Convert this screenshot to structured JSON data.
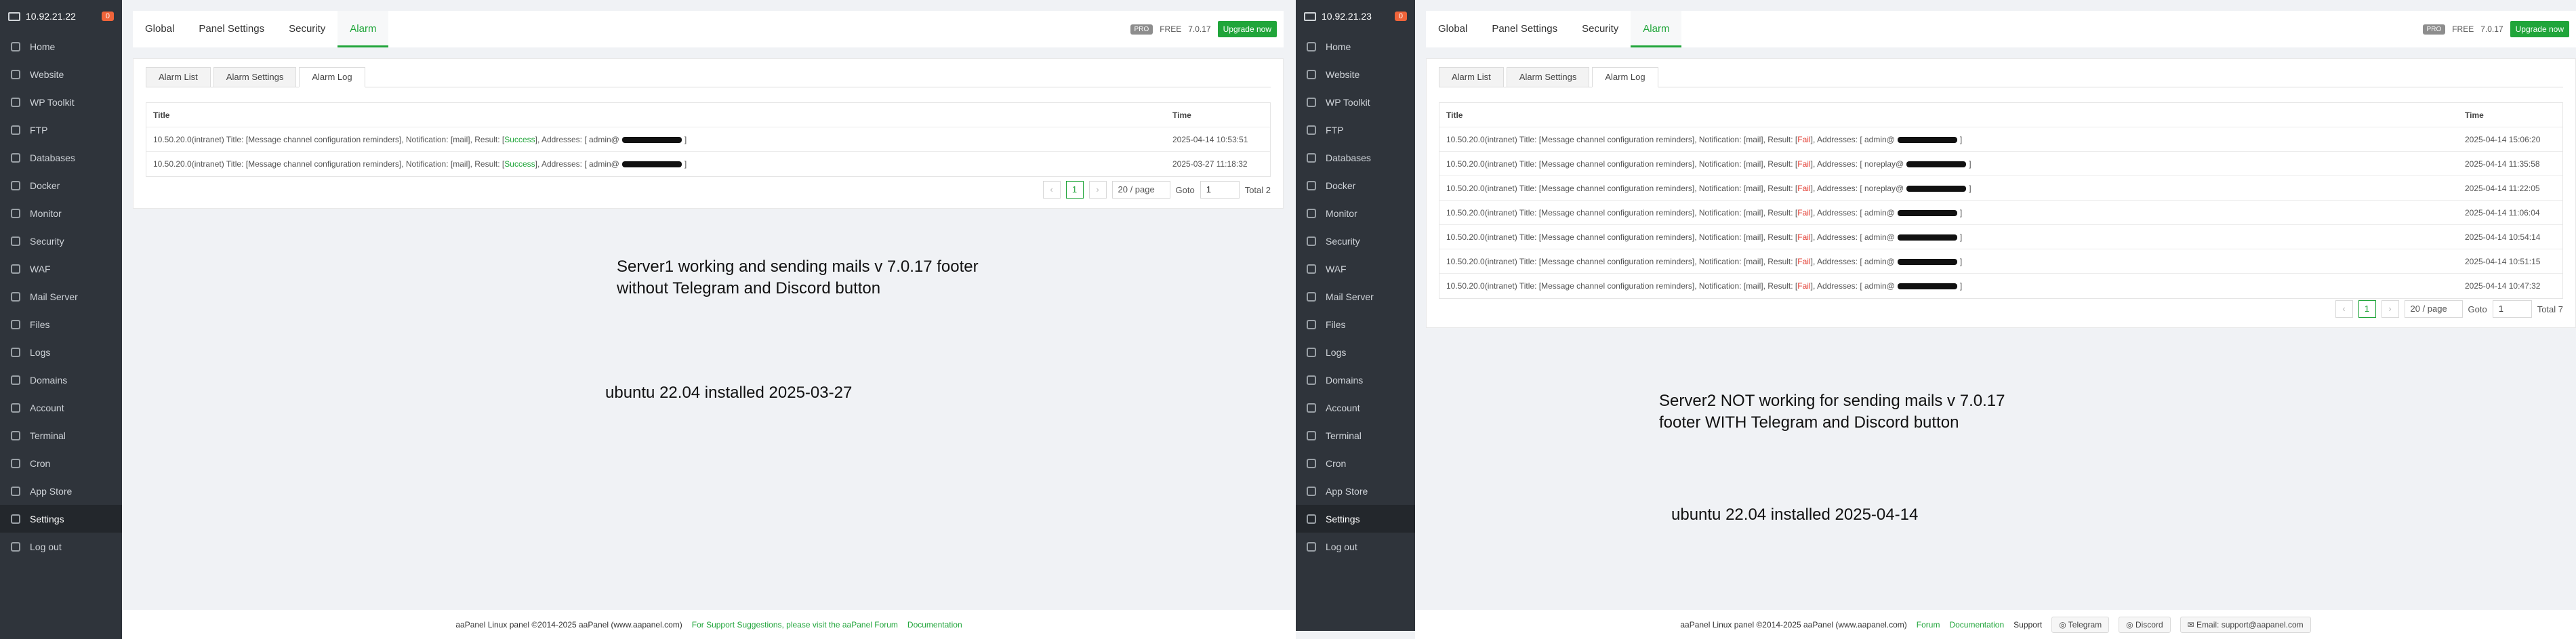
{
  "panels": [
    {
      "sidebar": {
        "ip": "10.92.21.22",
        "badge": "0",
        "items": [
          "Home",
          "Website",
          "WP Toolkit",
          "FTP",
          "Databases",
          "Docker",
          "Monitor",
          "Security",
          "WAF",
          "Mail Server",
          "Files",
          "Logs",
          "Domains",
          "Account",
          "Terminal",
          "Cron",
          "App Store",
          "Settings",
          "Log out"
        ],
        "active_index": 17
      },
      "tabs": [
        "Global",
        "Panel Settings",
        "Security",
        "Alarm"
      ],
      "active_tab": 3,
      "top_right": {
        "pro": "PRO",
        "free": "FREE",
        "version": "7.0.17",
        "upgrade": "Upgrade now"
      },
      "subtabs": [
        "Alarm List",
        "Alarm Settings",
        "Alarm Log"
      ],
      "active_subtab": 2,
      "table": {
        "headers": {
          "title": "Title",
          "time": "Time"
        },
        "rows": [
          {
            "prefix": "10.50.20.0(intranet) Title: [Message channel configuration reminders], Notification: [mail], Result: [",
            "status": "Success",
            "mid": "], Addresses: [ admin@",
            "suffix": "]",
            "time": "2025-04-14 10:53:51"
          },
          {
            "prefix": "10.50.20.0(intranet) Title: [Message channel configuration reminders], Notification: [mail], Result: [",
            "status": "Success",
            "mid": "], Addresses: [ admin@",
            "suffix": "]",
            "time": "2025-03-27 11:18:32"
          }
        ]
      },
      "pager": {
        "page": "1",
        "per_page": "20 / page",
        "goto_label": "Goto",
        "goto_value": "1",
        "total": "Total 2"
      },
      "notes": [
        {
          "lines": [
            "Server1 working and sending mails v 7.0.17 footer",
            "without Telegram and Discord button"
          ]
        },
        {
          "lines": [
            "ubuntu 22.04 installed 2025-03-27"
          ]
        }
      ],
      "footer": {
        "copyright": "aaPanel Linux panel ©2014-2025 aaPanel (www.aapanel.com)",
        "link1": "For Support Suggestions, please visit the aaPanel Forum",
        "link2": "Documentation"
      }
    },
    {
      "sidebar": {
        "ip": "10.92.21.23",
        "badge": "0",
        "items": [
          "Home",
          "Website",
          "WP Toolkit",
          "FTP",
          "Databases",
          "Docker",
          "Monitor",
          "Security",
          "WAF",
          "Mail Server",
          "Files",
          "Logs",
          "Domains",
          "Account",
          "Terminal",
          "Cron",
          "App Store",
          "Settings",
          "Log out"
        ],
        "active_index": 17
      },
      "tabs": [
        "Global",
        "Panel Settings",
        "Security",
        "Alarm"
      ],
      "active_tab": 3,
      "top_right": {
        "pro": "PRO",
        "free": "FREE",
        "version": "7.0.17",
        "upgrade": "Upgrade now"
      },
      "subtabs": [
        "Alarm List",
        "Alarm Settings",
        "Alarm Log"
      ],
      "active_subtab": 2,
      "table": {
        "headers": {
          "title": "Title",
          "time": "Time"
        },
        "rows": [
          {
            "prefix": "10.50.20.0(intranet) Title: [Message channel configuration reminders], Notification: [mail], Result: [",
            "status": "Fail",
            "mid": "], Addresses: [ admin@",
            "suffix": "]",
            "time": "2025-04-14 15:06:20"
          },
          {
            "prefix": "10.50.20.0(intranet) Title: [Message channel configuration reminders], Notification: [mail], Result: [",
            "status": "Fail",
            "mid": "], Addresses: [ noreplay@",
            "suffix": "]",
            "time": "2025-04-14 11:35:58"
          },
          {
            "prefix": "10.50.20.0(intranet) Title: [Message channel configuration reminders], Notification: [mail], Result: [",
            "status": "Fail",
            "mid": "], Addresses: [ noreplay@",
            "suffix": "]",
            "time": "2025-04-14 11:22:05"
          },
          {
            "prefix": "10.50.20.0(intranet) Title: [Message channel configuration reminders], Notification: [mail], Result: [",
            "status": "Fail",
            "mid": "], Addresses: [ admin@",
            "suffix": "]",
            "time": "2025-04-14 11:06:04"
          },
          {
            "prefix": "10.50.20.0(intranet) Title: [Message channel configuration reminders], Notification: [mail], Result: [",
            "status": "Fail",
            "mid": "], Addresses: [ admin@",
            "suffix": "]",
            "time": "2025-04-14 10:54:14"
          },
          {
            "prefix": "10.50.20.0(intranet) Title: [Message channel configuration reminders], Notification: [mail], Result: [",
            "status": "Fail",
            "mid": "], Addresses: [ admin@",
            "suffix": "]",
            "time": "2025-04-14 10:51:15"
          },
          {
            "prefix": "10.50.20.0(intranet) Title: [Message channel configuration reminders], Notification: [mail], Result: [",
            "status": "Fail",
            "mid": "], Addresses: [ admin@",
            "suffix": "]",
            "time": "2025-04-14 10:47:32"
          }
        ]
      },
      "pager": {
        "page": "1",
        "per_page": "20 / page",
        "goto_label": "Goto",
        "goto_value": "1",
        "total": "Total 7"
      },
      "notes": [
        {
          "lines": [
            "Server2 NOT working for sending mails v 7.0.17",
            "footer WITH Telegram and Discord button"
          ]
        },
        {
          "lines": [
            "ubuntu 22.04 installed 2025-04-14"
          ]
        }
      ],
      "footer": {
        "copyright": "aaPanel Linux panel ©2014-2025 aaPanel (www.aapanel.com)",
        "link1": "Forum",
        "link2": "Documentation",
        "support": "Support",
        "telegram": "Telegram",
        "discord": "Discord",
        "email": "Email: support@aapanel.com"
      }
    }
  ]
}
